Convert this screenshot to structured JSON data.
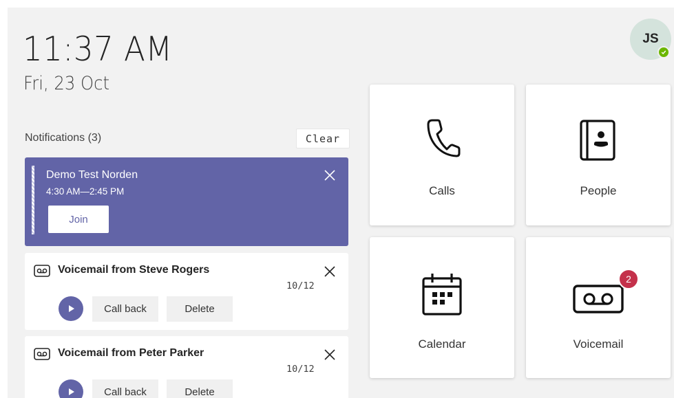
{
  "clock": {
    "time": "11:37 AM",
    "date": "Fri, 23 Oct"
  },
  "user": {
    "initials": "JS",
    "presence": "available",
    "presence_color": "#6bb700"
  },
  "notifications": {
    "title": "Notifications (3)",
    "clear_label": "Clear",
    "meeting": {
      "name": "Demo Test Norden",
      "time": "4:30 AM—2:45 PM",
      "join_label": "Join",
      "color": "#6264a7"
    },
    "voicemails": [
      {
        "title": "Voicemail from Steve Rogers",
        "date": "10/12",
        "call_back_label": "Call back",
        "delete_label": "Delete"
      },
      {
        "title": "Voicemail from Peter Parker",
        "date": "10/12",
        "call_back_label": "Call back",
        "delete_label": "Delete"
      }
    ]
  },
  "tiles": {
    "calls": {
      "label": "Calls",
      "icon": "phone-icon"
    },
    "people": {
      "label": "People",
      "icon": "contact-book-icon"
    },
    "calendar": {
      "label": "Calendar",
      "icon": "calendar-icon"
    },
    "voicemail": {
      "label": "Voicemail",
      "icon": "voicemail-icon",
      "badge": "2"
    }
  },
  "colors": {
    "accent": "#6264a7",
    "badge": "#c4314b",
    "background": "#f2f2f2"
  }
}
